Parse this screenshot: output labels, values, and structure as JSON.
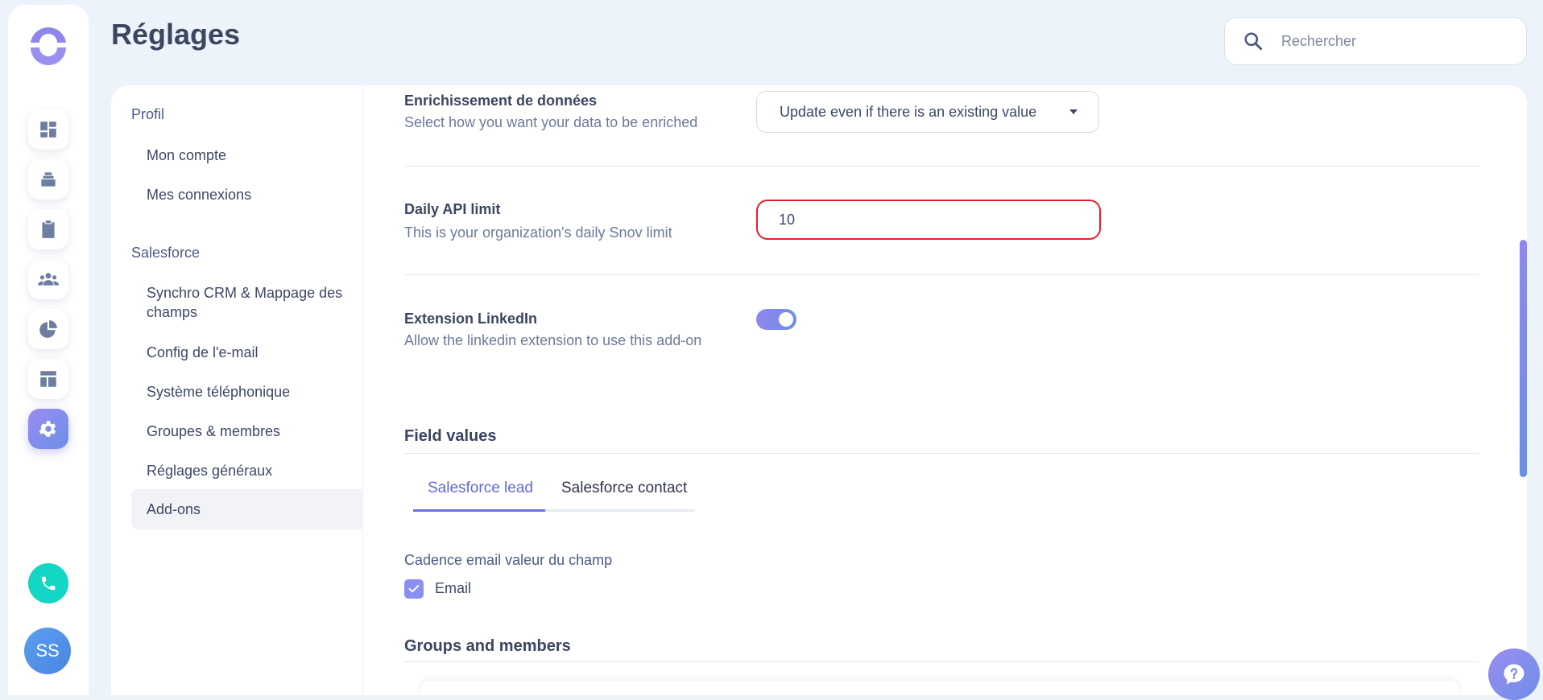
{
  "header": {
    "title": "Réglages",
    "search_placeholder": "Rechercher"
  },
  "rail": {
    "avatar_initials": "SS",
    "items": [
      "dashboard-icon",
      "layers-icon",
      "clipboard-icon",
      "people-icon",
      "pie-chart-icon",
      "layout-icon",
      "gear-icon"
    ],
    "active": "gear-icon",
    "accent": "#7f8cea",
    "phone_color": "#13d6c4"
  },
  "settings_nav": {
    "profil": {
      "title": "Profil",
      "items": [
        "Mon compte",
        "Mes connexions"
      ]
    },
    "salesforce": {
      "title": "Salesforce",
      "items": [
        "Synchro CRM & Mappage des champs",
        "Config de l'e-mail",
        "Système téléphonique",
        "Groupes & membres",
        "Réglages généraux",
        "Add-ons"
      ]
    },
    "active": "Add-ons"
  },
  "content": {
    "enrichment": {
      "label": "Enrichissement de données",
      "description": "Select how you want your data to be enriched",
      "selected": "Update even if there is an existing value"
    },
    "api_limit": {
      "label": "Daily API limit",
      "description": "This is your organization's daily Snov limit",
      "value": "10",
      "error_color": "#e0222f"
    },
    "linkedin": {
      "label": "Extension LinkedIn",
      "description": "Allow the linkedin extension to use this add-on",
      "enabled": true
    },
    "field_values": {
      "title": "Field values",
      "tabs": [
        "Salesforce lead",
        "Salesforce contact"
      ],
      "active_tab": "Salesforce lead",
      "field_label": "Cadence email valeur du champ",
      "checkbox_label": "Email",
      "checked": true
    },
    "groups": {
      "title": "Groups and members"
    }
  }
}
